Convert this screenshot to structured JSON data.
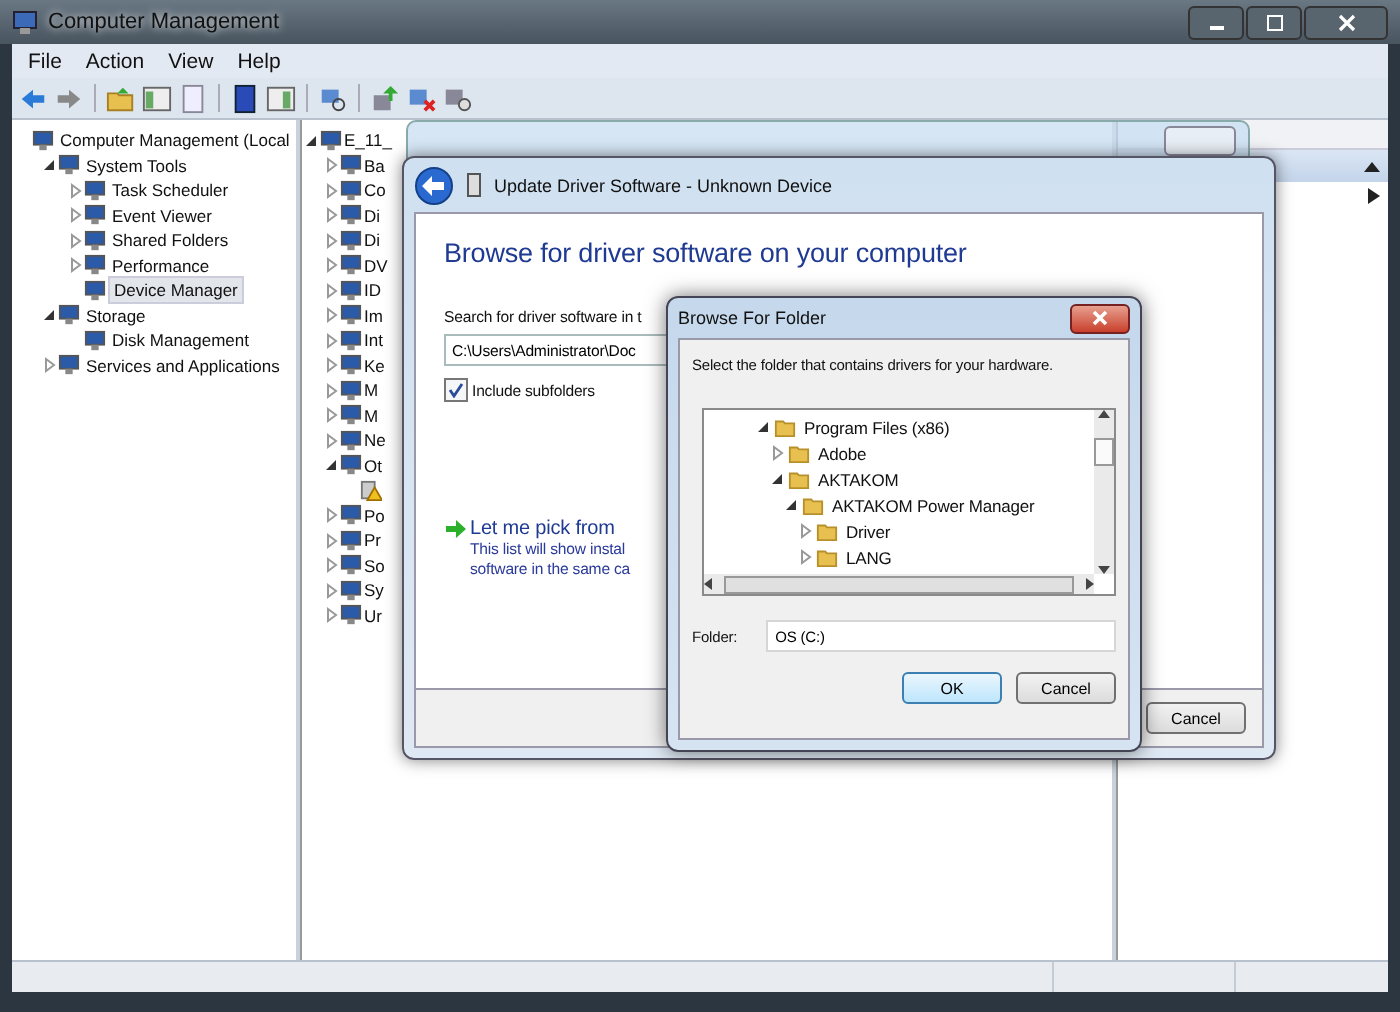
{
  "window": {
    "title": "Computer Management"
  },
  "menu": [
    {
      "label": "File"
    },
    {
      "label": "Action"
    },
    {
      "label": "View"
    },
    {
      "label": "Help"
    }
  ],
  "left_tree": [
    {
      "label": "Computer Management (Local",
      "selected": false,
      "children": [
        {
          "label": "System Tools",
          "expanded": true,
          "selected": false,
          "children": [
            {
              "label": "Task Scheduler",
              "expanded": false,
              "selected": false
            },
            {
              "label": "Event Viewer",
              "expanded": false,
              "selected": false
            },
            {
              "label": "Shared Folders",
              "expanded": false,
              "selected": false
            },
            {
              "label": "Performance",
              "expanded": false,
              "selected": false
            },
            {
              "label": "Device Manager",
              "selected": true
            }
          ]
        },
        {
          "label": "Storage",
          "expanded": true,
          "selected": false,
          "children": [
            {
              "label": "Disk Management",
              "selected": false
            }
          ]
        },
        {
          "label": "Services and Applications",
          "expanded": false,
          "selected": false
        }
      ]
    }
  ],
  "device_tree": [
    {
      "label": "E_11_",
      "expanded": true,
      "children": [
        {
          "label": "Ba",
          "expanded": false
        },
        {
          "label": "Co",
          "expanded": false
        },
        {
          "label": "Di",
          "expanded": false
        },
        {
          "label": "Di",
          "expanded": false
        },
        {
          "label": "DV",
          "expanded": false
        },
        {
          "label": "ID",
          "expanded": false
        },
        {
          "label": "Im",
          "expanded": false
        },
        {
          "label": "Int",
          "expanded": false
        },
        {
          "label": "Ke",
          "expanded": false
        },
        {
          "label": "M",
          "expanded": false
        },
        {
          "label": "M",
          "expanded": false
        },
        {
          "label": "Ne",
          "expanded": false
        },
        {
          "label": "Ot",
          "expanded": true,
          "children": [
            {
              "kind": "unknown-device"
            }
          ]
        },
        {
          "label": "Po",
          "expanded": false
        },
        {
          "label": "Pr",
          "expanded": false
        },
        {
          "label": "So",
          "expanded": false
        },
        {
          "label": "Sy",
          "expanded": false
        },
        {
          "label": "Ur",
          "expanded": false
        }
      ]
    }
  ],
  "update_dialog": {
    "title": "Update Driver Software - Unknown Device",
    "heading": "Browse for driver software on your computer",
    "search_label": "Search for driver software in t",
    "path_value": "C:\\Users\\Administrator\\Doc",
    "include_subfolders": {
      "label": "Include subfolders",
      "checked": true
    },
    "pick_link": "Let me pick from",
    "pick_description": [
      "This list will show instal",
      "software in the same ca"
    ],
    "buttons": [
      {
        "label": "Cancel",
        "default": false
      }
    ]
  },
  "browse_dialog": {
    "title": "Browse For Folder",
    "instruction": "Select the folder that contains drivers for your hardware.",
    "folders": [
      {
        "label": "Program Files (x86)",
        "expanded": true,
        "children": [
          {
            "label": "Adobe",
            "expanded": false
          },
          {
            "label": "AKTAKOM",
            "expanded": true,
            "children": [
              {
                "label": "AKTAKOM Power Manager",
                "expanded": true,
                "children": [
                  {
                    "label": "Driver",
                    "expanded": false
                  },
                  {
                    "label": "LANG",
                    "expanded": false
                  }
                ]
              }
            ]
          }
        ]
      }
    ],
    "folder_label": "Folder:",
    "folder_value": "OS (C:)",
    "buttons": [
      {
        "label": "OK",
        "default": true
      },
      {
        "label": "Cancel",
        "default": false
      }
    ]
  }
}
